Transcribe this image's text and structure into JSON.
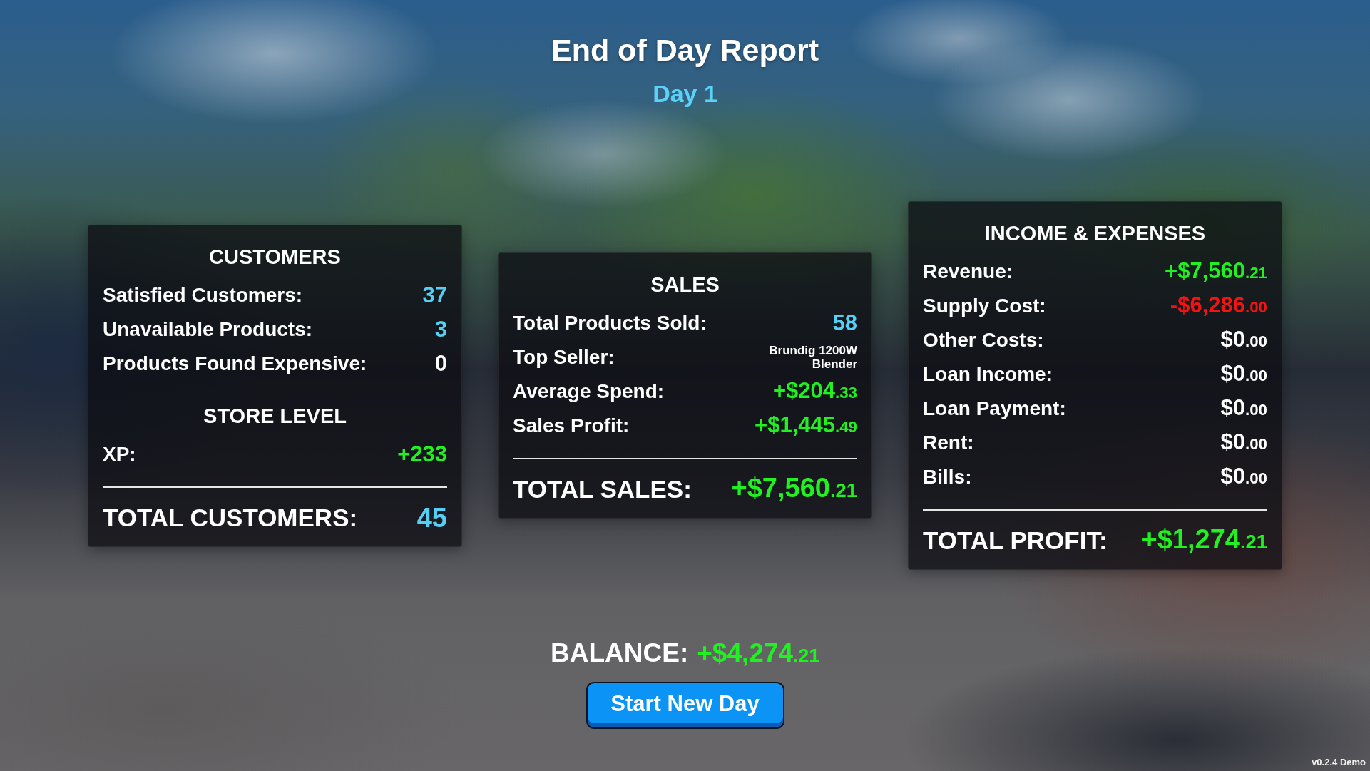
{
  "header": {
    "title": "End of Day Report",
    "subtitle": "Day 1"
  },
  "panels": [
    {
      "sections": [
        {
          "title": "CUSTOMERS",
          "rows": [
            {
              "label": "Satisfied Customers:",
              "value": {
                "kind": "count",
                "text": "37",
                "color": "#57cff4"
              }
            },
            {
              "label": "Unavailable Products:",
              "value": {
                "kind": "count",
                "text": "3",
                "color": "#57cff4"
              }
            },
            {
              "label": "Products Found Expensive:",
              "value": {
                "kind": "count",
                "text": "0",
                "color": "#ffffff"
              }
            }
          ]
        },
        {
          "title": "STORE LEVEL",
          "rows": [
            {
              "label": "XP:",
              "value": {
                "kind": "count",
                "text": "+233",
                "color": "#21f021"
              }
            }
          ]
        }
      ],
      "total": {
        "label": "TOTAL CUSTOMERS:",
        "value": {
          "kind": "count",
          "text": "45",
          "color": "#57cff4"
        }
      }
    },
    {
      "sections": [
        {
          "title": "SALES",
          "rows": [
            {
              "label": "Total Products Sold:",
              "value": {
                "kind": "count",
                "text": "58",
                "color": "#57cff4"
              }
            },
            {
              "label": "Top Seller:",
              "value": {
                "kind": "product",
                "text": "Brundig 1200W Blender",
                "color": "#ffffff"
              }
            },
            {
              "label": "Average Spend:",
              "value": {
                "kind": "money",
                "whole": "+$204",
                "cents": ".33",
                "color": "#21f021"
              }
            },
            {
              "label": "Sales Profit:",
              "value": {
                "kind": "money",
                "whole": "+$1,445",
                "cents": ".49",
                "color": "#21f021"
              }
            }
          ]
        }
      ],
      "total": {
        "label": "TOTAL SALES:",
        "value": {
          "kind": "money",
          "whole": "+$7,560",
          "cents": ".21",
          "color": "#21f021"
        }
      }
    },
    {
      "sections": [
        {
          "title": "INCOME & EXPENSES",
          "rows": [
            {
              "label": "Revenue:",
              "value": {
                "kind": "money",
                "whole": "+$7,560",
                "cents": ".21",
                "color": "#21f021"
              }
            },
            {
              "label": "Supply Cost:",
              "value": {
                "kind": "money",
                "whole": "-$6,286",
                "cents": ".00",
                "color": "#f21414"
              }
            },
            {
              "label": "Other Costs:",
              "value": {
                "kind": "money",
                "whole": "$0",
                "cents": ".00",
                "color": "#ffffff"
              }
            },
            {
              "label": "Loan Income:",
              "value": {
                "kind": "money",
                "whole": "$0",
                "cents": ".00",
                "color": "#ffffff"
              }
            },
            {
              "label": "Loan Payment:",
              "value": {
                "kind": "money",
                "whole": "$0",
                "cents": ".00",
                "color": "#ffffff"
              }
            },
            {
              "label": "Rent:",
              "value": {
                "kind": "money",
                "whole": "$0",
                "cents": ".00",
                "color": "#ffffff"
              }
            },
            {
              "label": "Bills:",
              "value": {
                "kind": "money",
                "whole": "$0",
                "cents": ".00",
                "color": "#ffffff"
              }
            }
          ]
        }
      ],
      "total": {
        "label": "TOTAL PROFIT:",
        "value": {
          "kind": "money",
          "whole": "+$1,274",
          "cents": ".21",
          "color": "#21f021"
        }
      }
    }
  ],
  "balance": {
    "label": "BALANCE:",
    "value": {
      "kind": "money",
      "whole": "+$4,274",
      "cents": ".21",
      "color": "#21f021"
    }
  },
  "button": {
    "label": "Start New Day"
  },
  "version": "v0.2.4 Demo"
}
